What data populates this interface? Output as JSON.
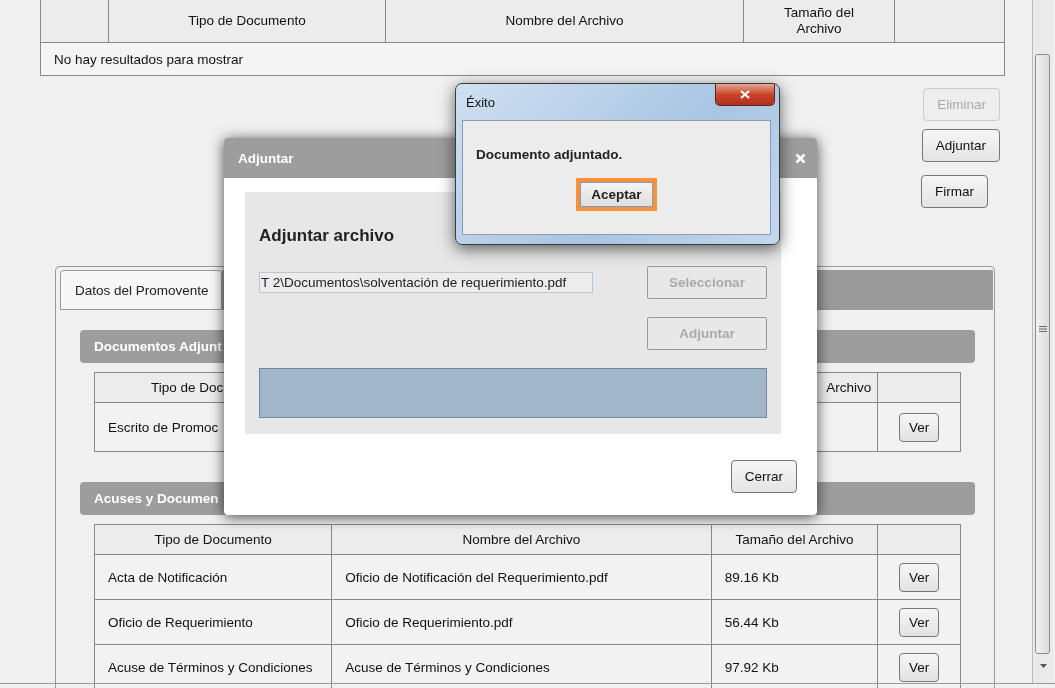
{
  "top_table": {
    "columns": [
      "Tipo de Documento",
      "Nombre del Archivo",
      "Tamaño del Archivo"
    ],
    "empty_message": "No hay resultados para mostrar"
  },
  "actions": [
    {
      "label": "Eliminar",
      "disabled": true
    },
    {
      "label": "Adjuntar",
      "disabled": false
    },
    {
      "label": "Firmar",
      "disabled": false
    }
  ],
  "tabs": [
    {
      "label": "Datos del Promovente",
      "selected": true
    }
  ],
  "sections": [
    {
      "title": "Documentos Adjunt",
      "columns": {
        "tipo": "Tipo de Doc",
        "tamano": "Archivo"
      },
      "rows": [
        {
          "tipo": "Escrito de Promoc",
          "action": "Ver"
        }
      ]
    },
    {
      "title": "Acuses y Documen",
      "columns": {
        "tipo": "Tipo de Documento",
        "nombre": "Nombre del Archivo",
        "tamano": "Tamaño del Archivo"
      },
      "rows": [
        {
          "tipo": "Acta de Notificación",
          "nombre": "Oficio de Notificación del Requerimiento.pdf",
          "tamano": "89.16 Kb",
          "action": "Ver"
        },
        {
          "tipo": "Oficio de Requerimiento",
          "nombre": "Oficio de Requerimiento.pdf",
          "tamano": "56.44 Kb",
          "action": "Ver"
        },
        {
          "tipo": "Acuse de Términos y Condiciones",
          "nombre": "Acuse de Términos y Condiciones",
          "tamano": "97.92 Kb",
          "action": "Ver"
        }
      ]
    }
  ],
  "attach_dialog": {
    "title": "Adjuntar",
    "heading": "Adjuntar archivo",
    "file_path": "T 2\\Documentos\\solventación de requerimiento.pdf",
    "select_button": {
      "label": "Seleccionar",
      "disabled": true
    },
    "attach_button": {
      "label": "Adjuntar",
      "disabled": true
    },
    "progress": {
      "level": 1
    },
    "close_button": "Cerrar"
  },
  "success_dialog": {
    "title": "Éxito",
    "message": "Documento adjuntado.",
    "ok_button": {
      "label": "Aceptar",
      "highlighted": true
    }
  }
}
